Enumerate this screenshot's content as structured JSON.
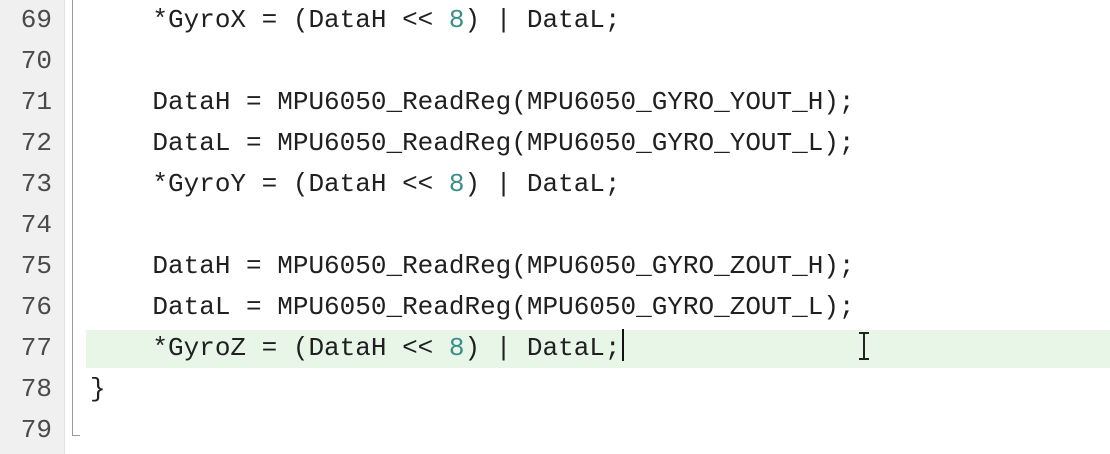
{
  "editor": {
    "lines": [
      {
        "number": "69",
        "indent": "    ",
        "text": "*GyroX = (DataH << ",
        "num": "8",
        "tail": ") | DataL;"
      },
      {
        "number": "70",
        "indent": "",
        "text": "",
        "num": "",
        "tail": ""
      },
      {
        "number": "71",
        "indent": "    ",
        "text": "DataH = MPU6050_ReadReg(MPU6050_GYRO_YOUT_H);",
        "num": "",
        "tail": ""
      },
      {
        "number": "72",
        "indent": "    ",
        "text": "DataL = MPU6050_ReadReg(MPU6050_GYRO_YOUT_L);",
        "num": "",
        "tail": ""
      },
      {
        "number": "73",
        "indent": "    ",
        "text": "*GyroY = (DataH << ",
        "num": "8",
        "tail": ") | DataL;"
      },
      {
        "number": "74",
        "indent": "",
        "text": "",
        "num": "",
        "tail": ""
      },
      {
        "number": "75",
        "indent": "    ",
        "text": "DataH = MPU6050_ReadReg(MPU6050_GYRO_ZOUT_H);",
        "num": "",
        "tail": ""
      },
      {
        "number": "76",
        "indent": "    ",
        "text": "DataL = MPU6050_ReadReg(MPU6050_GYRO_ZOUT_L);",
        "num": "",
        "tail": ""
      },
      {
        "number": "77",
        "indent": "    ",
        "text": "*GyroZ = (DataH << ",
        "num": "8",
        "tail": ") | DataL;",
        "current": true
      },
      {
        "number": "78",
        "indent": "",
        "text": "}",
        "num": "",
        "tail": ""
      },
      {
        "number": "79",
        "indent": "",
        "text": "",
        "num": "",
        "tail": ""
      }
    ],
    "colors": {
      "current_line_bg": "#e8f6e8",
      "number_literal": "#3b8e8a",
      "gutter_bg": "#f0f0f0"
    }
  }
}
